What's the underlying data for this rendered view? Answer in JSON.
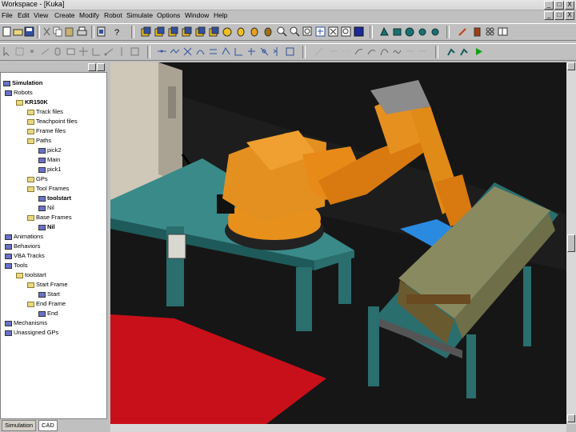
{
  "window": {
    "title": "Workspace - [Kuka]",
    "buttons": [
      "_",
      "□",
      "X"
    ]
  },
  "menubar": {
    "items": [
      "File",
      "Edit",
      "View",
      "Create",
      "Modify",
      "Robot",
      "Simulate",
      "Options",
      "Window",
      "Help"
    ],
    "window_buttons": [
      "_",
      "□",
      "X"
    ]
  },
  "tree": {
    "items": [
      {
        "label": "Simulation",
        "bold": true
      },
      {
        "label": "Robots"
      },
      {
        "label": "KR150K",
        "bold": true
      },
      {
        "label": "Track files"
      },
      {
        "label": "Teachpoint files"
      },
      {
        "label": "Frame files"
      },
      {
        "label": "Paths"
      },
      {
        "label": "pick2"
      },
      {
        "label": "Main"
      },
      {
        "label": "pick1"
      },
      {
        "label": "GPs"
      },
      {
        "label": "Tool Frames"
      },
      {
        "label": "toolstart",
        "bold": true
      },
      {
        "label": "Nil"
      },
      {
        "label": "Base Frames"
      },
      {
        "label": "Nil",
        "bold": true
      },
      {
        "label": "Animations"
      },
      {
        "label": "Behaviors"
      },
      {
        "label": "VBA Tracks"
      },
      {
        "label": "Tools"
      },
      {
        "label": "toolstart"
      },
      {
        "label": "Start Frame"
      },
      {
        "label": "Start"
      },
      {
        "label": "End Frame"
      },
      {
        "label": "End"
      },
      {
        "label": "Mechanisms"
      },
      {
        "label": "Unassigned GPs"
      }
    ]
  },
  "bottom_tabs": [
    "Simulation",
    "CAD"
  ],
  "colors": {
    "robot_orange": "#e8901c",
    "table_teal": "#3a8a8a",
    "floor_red": "#d0101a",
    "pad_blue": "#2a8ae0"
  }
}
